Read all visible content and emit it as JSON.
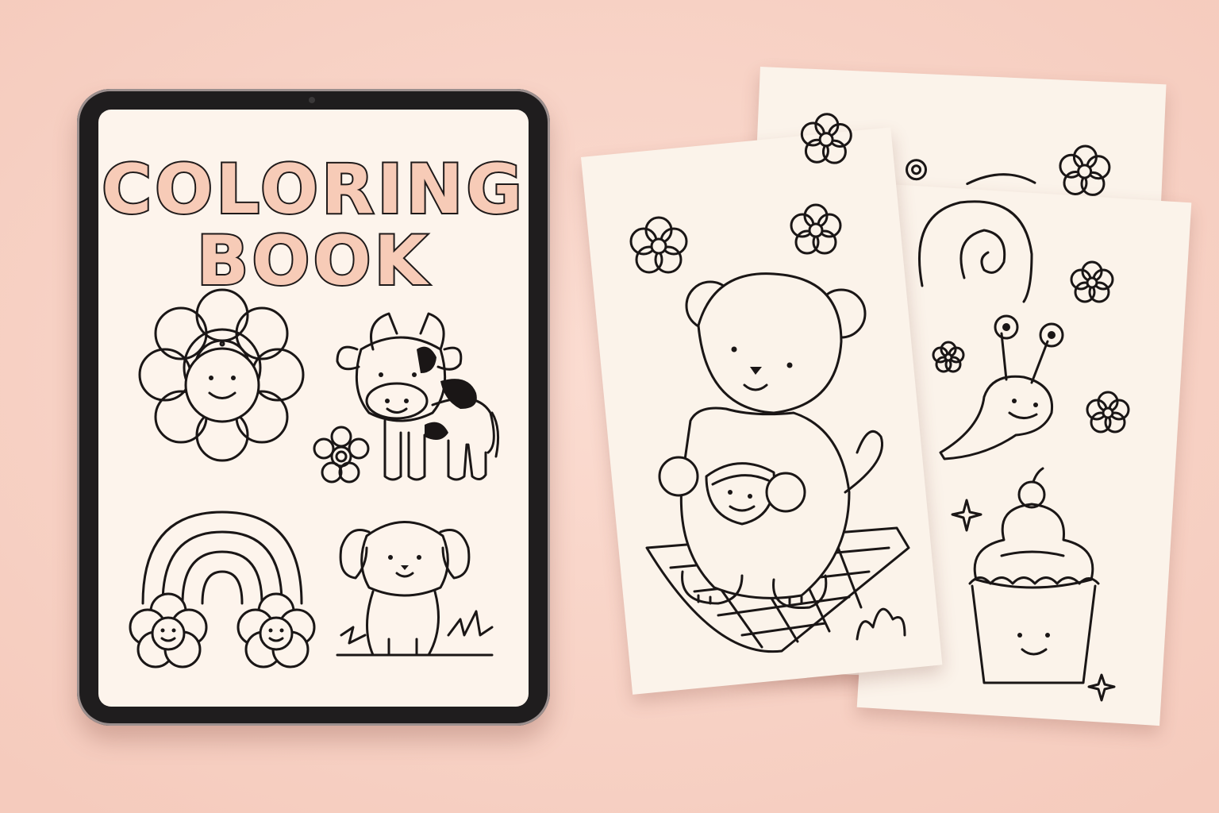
{
  "colors": {
    "background": "#f9d5c9",
    "tablet_frame": "#1f1d1e",
    "screen": "#fdf4ec",
    "title_fill": "#f7cbb7",
    "ink": "#1a1616",
    "paper": "#fbf3ea"
  },
  "tablet": {
    "title_line_1": "COLORING",
    "title_line_2": "BOOK",
    "illustrations": [
      "smiling-flower",
      "cow",
      "rainbow-with-flowers",
      "puppy"
    ]
  },
  "pages": [
    {
      "id": "back-page",
      "illustrations": [
        "flowers"
      ]
    },
    {
      "id": "right-page",
      "illustrations": [
        "snail",
        "flowers",
        "cupcake",
        "sparkles"
      ]
    },
    {
      "id": "front-page",
      "illustrations": [
        "bear-with-watermelon",
        "picnic-blanket",
        "flowers"
      ]
    }
  ]
}
